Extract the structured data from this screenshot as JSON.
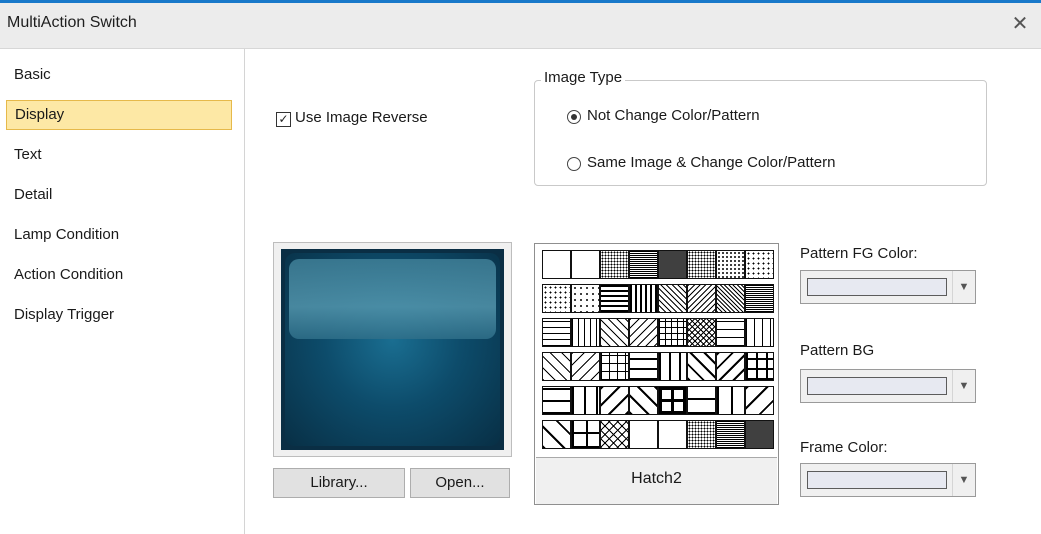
{
  "window": {
    "title": "MultiAction Switch",
    "close_glyph": "✕"
  },
  "sidebar": {
    "items": [
      {
        "label": "Basic",
        "selected": false
      },
      {
        "label": "Display",
        "selected": true
      },
      {
        "label": "Text",
        "selected": false
      },
      {
        "label": "Detail",
        "selected": false
      },
      {
        "label": "Lamp Condition",
        "selected": false
      },
      {
        "label": "Action Condition",
        "selected": false
      },
      {
        "label": "Display Trigger",
        "selected": false
      }
    ]
  },
  "display": {
    "use_image_reverse": {
      "label": "Use Image Reverse",
      "checked": true,
      "check_glyph": "✓"
    },
    "image_type": {
      "title": "Image Type",
      "options": [
        {
          "label": "Not Change Color/Pattern",
          "selected": true
        },
        {
          "label": "Same Image & Change Color/Pattern",
          "selected": false
        }
      ]
    },
    "buttons": {
      "library": "Library...",
      "open": "Open..."
    },
    "pattern": {
      "selected_name": "Hatch2",
      "rows": 6,
      "cols": 8
    },
    "pattern_fg": {
      "label": "Pattern FG Color:",
      "arrow": "▼"
    },
    "pattern_bg": {
      "label": "Pattern BG",
      "arrow": "▼"
    },
    "frame_color": {
      "label": "Frame Color:",
      "arrow": "▼"
    }
  },
  "colors": {
    "selected_bg": "#fde8a5",
    "selected_border": "#e6b94a",
    "title_bar": "#ececec",
    "accent_line": "#1979ca",
    "swatch": "#e7e9f1"
  }
}
